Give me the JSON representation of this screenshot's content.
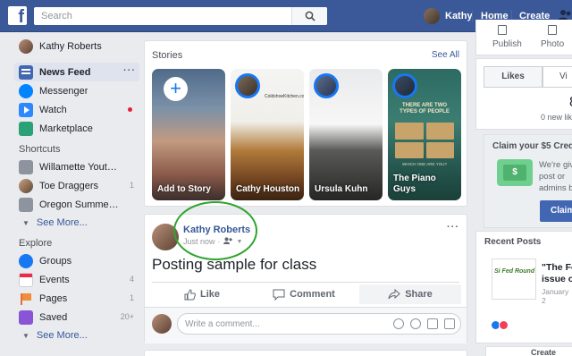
{
  "topbar": {
    "logo": "f",
    "search_placeholder": "Search",
    "user_name": "Kathy",
    "home": "Home",
    "create": "Create",
    "brand_color": "#3b5998"
  },
  "sidebar": {
    "profile": "Kathy Roberts",
    "items": [
      {
        "label": "News Feed",
        "icon": "newsfeed-icon"
      },
      {
        "label": "Messenger",
        "icon": "messenger-icon"
      },
      {
        "label": "Watch",
        "icon": "watch-icon"
      },
      {
        "label": "Marketplace",
        "icon": "marketplace-icon"
      }
    ],
    "shortcuts_title": "Shortcuts",
    "shortcuts": [
      {
        "label": "Willamette Youth C...",
        "count": ""
      },
      {
        "label": "Toe Draggers",
        "count": "1"
      },
      {
        "label": "Oregon Summer F...",
        "count": ""
      }
    ],
    "see_more": "See More...",
    "explore_title": "Explore",
    "explore": [
      {
        "label": "Groups",
        "count": ""
      },
      {
        "label": "Events",
        "count": "4"
      },
      {
        "label": "Pages",
        "count": "1"
      },
      {
        "label": "Saved",
        "count": "20+"
      }
    ],
    "see_more_2": "See More..."
  },
  "stories": {
    "title": "Stories",
    "see_all": "See All",
    "items": [
      {
        "name": "Add to Story"
      },
      {
        "name": "Cathy Houston",
        "snippet": "ColdshoeKitchen.com"
      },
      {
        "name": "Ursula Kuhn"
      },
      {
        "name": "The Piano Guys",
        "banner": "THERE ARE TWO TYPES OF PEOPLE",
        "question": "WHICH ONE ARE YOU?"
      }
    ]
  },
  "post": {
    "author": "Kathy Roberts",
    "time": "Just now",
    "text": "Posting sample for class",
    "like": "Like",
    "comment": "Comment",
    "share": "Share",
    "comment_placeholder": "Write a comment..."
  },
  "right": {
    "publish": "Publish",
    "photo": "Photo",
    "likes_tab": "Likes",
    "vis_tab": "Vi",
    "likes_count": "8",
    "new_likes": "0 new lik",
    "claim_title": "Claim your $5 Credi",
    "claim_text": "We're giv a post or admins b",
    "claim_button": "Claim",
    "card_symbol": "$",
    "recent_title": "Recent Posts",
    "recent_logo": "Si Fed Round",
    "recent_headline": "\"The Fe issue o",
    "recent_date": "January 2",
    "create_label": "Create"
  }
}
